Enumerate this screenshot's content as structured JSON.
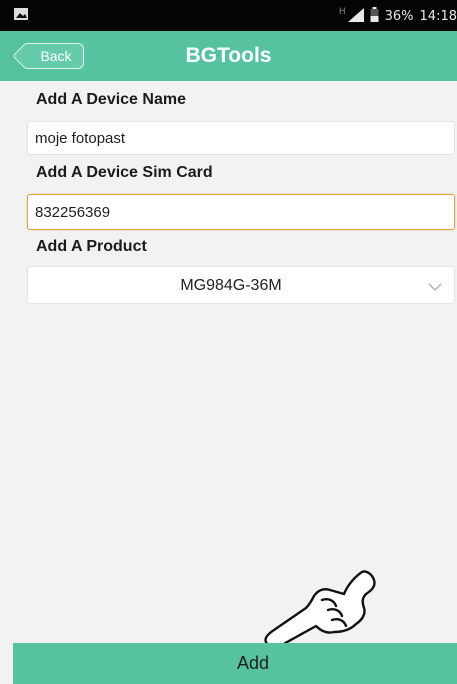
{
  "status_bar": {
    "network": "H",
    "battery": "36%",
    "time": "14:18"
  },
  "nav": {
    "back_label": "Back",
    "title": "BGTools"
  },
  "form": {
    "device_name_label": "Add A Device Name",
    "device_name_value": "moje fotopast",
    "sim_label": "Add A Device Sim Card",
    "sim_value": "832256369",
    "product_label": "Add A Product",
    "product_value": "MG984G-36M"
  },
  "footer": {
    "add_label": "Add"
  },
  "colors": {
    "accent": "#56c2a0",
    "focus_border": "#e2a24b",
    "background": "#f2f2f2"
  },
  "icons": [
    "image-icon",
    "signal-icon",
    "battery-icon",
    "chevron-down-icon",
    "pointing-hand-icon"
  ]
}
